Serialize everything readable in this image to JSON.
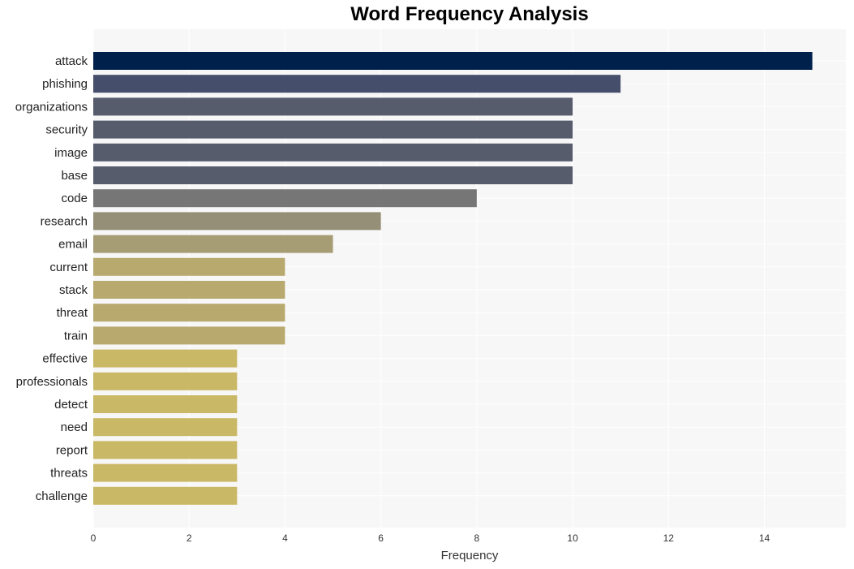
{
  "chart_data": {
    "type": "bar",
    "orientation": "horizontal",
    "title": "Word Frequency Analysis",
    "xlabel": "Frequency",
    "ylabel": "",
    "xlim": [
      0,
      15.7
    ],
    "xticks": [
      0,
      2,
      4,
      6,
      8,
      10,
      12,
      14
    ],
    "grid": true,
    "categories": [
      "attack",
      "phishing",
      "organizations",
      "security",
      "image",
      "base",
      "code",
      "research",
      "email",
      "current",
      "stack",
      "threat",
      "train",
      "effective",
      "professionals",
      "detect",
      "need",
      "report",
      "threats",
      "challenge"
    ],
    "values": [
      15,
      11,
      10,
      10,
      10,
      10,
      8,
      6,
      5,
      4,
      4,
      4,
      4,
      3,
      3,
      3,
      3,
      3,
      3,
      3
    ],
    "colors": [
      "#00204c",
      "#454f6b",
      "#575c6d",
      "#575c6d",
      "#575c6d",
      "#575c6d",
      "#777676",
      "#958f78",
      "#a69d75",
      "#b8a96f",
      "#b8a96f",
      "#b8a96f",
      "#b8a96f",
      "#c9b865",
      "#c9b865",
      "#c9b865",
      "#c9b865",
      "#c9b865",
      "#c9b865",
      "#c9b865"
    ],
    "background": "#f7f7f7"
  }
}
